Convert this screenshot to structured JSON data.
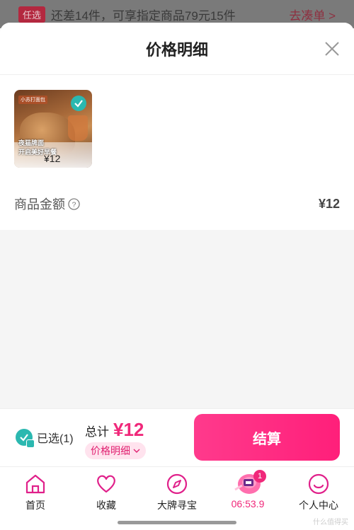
{
  "background_banner": {
    "tag": "任选",
    "text": "还差14件，可享指定商品79元15件",
    "link": "去凑单 >"
  },
  "sheet": {
    "title": "价格明细",
    "close_icon": "close-icon"
  },
  "product": {
    "brand_text": "小苏打面包",
    "promo_line1": "夜猫牌面",
    "promo_line2": "开启美好早餐",
    "price": "¥12",
    "selected": true
  },
  "amount": {
    "label": "商品金额",
    "help_icon": "question-icon",
    "value": "¥12"
  },
  "checkout": {
    "selected_label": "已选(1)",
    "total_label": "总计",
    "total_value": "¥12",
    "detail_pill": "价格明细",
    "button_label": "结算"
  },
  "tabs": [
    {
      "label": "首页",
      "icon": "home-icon"
    },
    {
      "label": "收藏",
      "icon": "heart-icon"
    },
    {
      "label": "大牌寻宝",
      "icon": "compass-icon"
    },
    {
      "label": "06:53.9",
      "icon": "timer-icon",
      "badge": "1"
    },
    {
      "label": "个人中心",
      "icon": "profile-icon"
    }
  ],
  "watermark": "什么值得买",
  "colors": {
    "accent": "#f0287a",
    "check": "#2bb8b0"
  }
}
